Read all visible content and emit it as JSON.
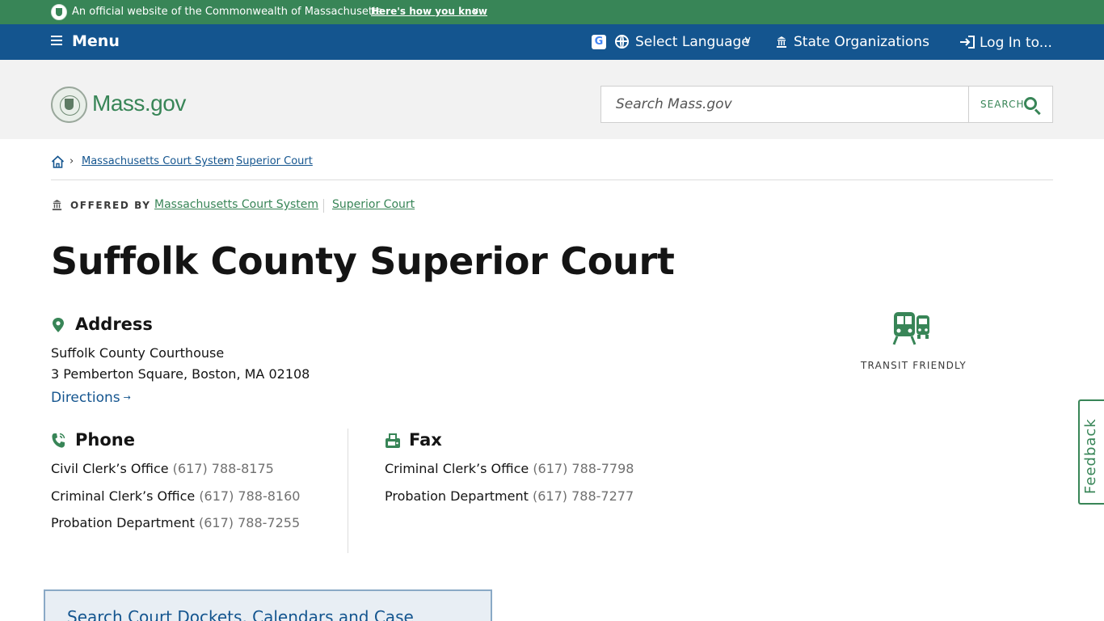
{
  "official_banner": {
    "text": "An official website of the Commonwealth of Massachusetts",
    "how_link": "Here's how you know",
    "colors": {
      "background": "#388557"
    }
  },
  "nav": {
    "menu_label": "Menu",
    "language_label": "Select Language",
    "state_orgs_label": "State Organizations",
    "login_label": "Log In to...",
    "google_glyph": "G",
    "colors": {
      "background": "#14558f"
    }
  },
  "header": {
    "logo_text": "Mass.gov",
    "search_placeholder": "Search Mass.gov",
    "search_button_label": "SEARCH"
  },
  "breadcrumb": {
    "items": [
      "Massachusetts Court System",
      "Superior Court"
    ]
  },
  "offered_by": {
    "label": "OFFERED BY",
    "orgs": [
      "Massachusetts Court System",
      "Superior Court"
    ]
  },
  "page_title": "Suffolk County Superior Court",
  "address": {
    "heading": "Address",
    "lines": [
      "Suffolk County Courthouse",
      "3 Pemberton Square, Boston, MA 02108"
    ],
    "directions_label": "Directions"
  },
  "phone": {
    "heading": "Phone",
    "entries": [
      {
        "label": "Civil Clerk’s Office",
        "number": "(617) 788-8175"
      },
      {
        "label": "Criminal Clerk’s Office",
        "number": "(617) 788-8160"
      },
      {
        "label": "Probation Department",
        "number": "(617) 788-7255"
      }
    ]
  },
  "fax": {
    "heading": "Fax",
    "entries": [
      {
        "label": "Criminal Clerk’s Office",
        "number": "(617) 788-7798"
      },
      {
        "label": "Probation Department",
        "number": "(617) 788-7277"
      }
    ]
  },
  "transit": {
    "label": "TRANSIT FRIENDLY"
  },
  "feedback_label": "Feedback",
  "card_title": "Search Court Dockets, Calendars and Case"
}
